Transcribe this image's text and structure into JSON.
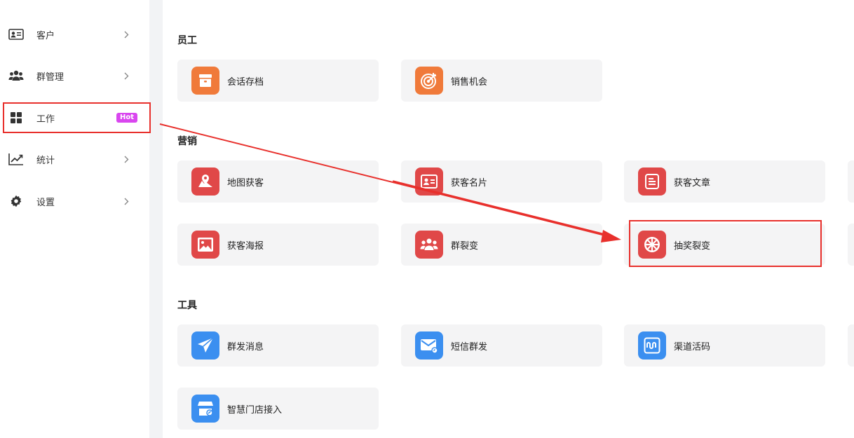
{
  "sidebar": {
    "items": [
      {
        "label": "客户",
        "icon": "contact-card-icon",
        "chevron": true
      },
      {
        "label": "群管理",
        "icon": "group-users-icon",
        "chevron": true
      },
      {
        "label": "工作",
        "icon": "grid-apps-icon",
        "chevron": false,
        "badge": "Hot"
      },
      {
        "label": "统计",
        "icon": "trend-chart-icon",
        "chevron": true
      },
      {
        "label": "设置",
        "icon": "gear-icon",
        "chevron": true
      }
    ]
  },
  "sections": {
    "staff": {
      "title": "员工",
      "cards": [
        {
          "label": "会话存档",
          "icon": "archive-box-icon",
          "color": "#f07a3a"
        },
        {
          "label": "销售机会",
          "icon": "target-icon",
          "color": "#f07a3a"
        }
      ]
    },
    "marketing": {
      "title": "营销",
      "cards": [
        {
          "label": "地图获客",
          "icon": "map-pin-icon",
          "color": "#e04848"
        },
        {
          "label": "获客名片",
          "icon": "business-card-icon",
          "color": "#e04848"
        },
        {
          "label": "获客文章",
          "icon": "article-icon",
          "color": "#e04848"
        },
        {
          "label": "获客海报",
          "icon": "poster-image-icon",
          "color": "#e04848"
        },
        {
          "label": "群裂变",
          "icon": "group-fission-icon",
          "color": "#e04848"
        },
        {
          "label": "抽奖裂变",
          "icon": "lottery-wheel-icon",
          "color": "#e04848"
        }
      ]
    },
    "tools": {
      "title": "工具",
      "cards": [
        {
          "label": "群发消息",
          "icon": "paper-plane-icon",
          "color": "#3b8ff0"
        },
        {
          "label": "短信群发",
          "icon": "mail-icon",
          "color": "#3b8ff0"
        },
        {
          "label": "渠道活码",
          "icon": "qr-code-icon",
          "color": "#3b8ff0"
        },
        {
          "label": "智慧门店接入",
          "icon": "store-icon",
          "color": "#3b8ff0"
        }
      ]
    }
  },
  "annotations": {
    "highlight_color": "#e8302c"
  }
}
